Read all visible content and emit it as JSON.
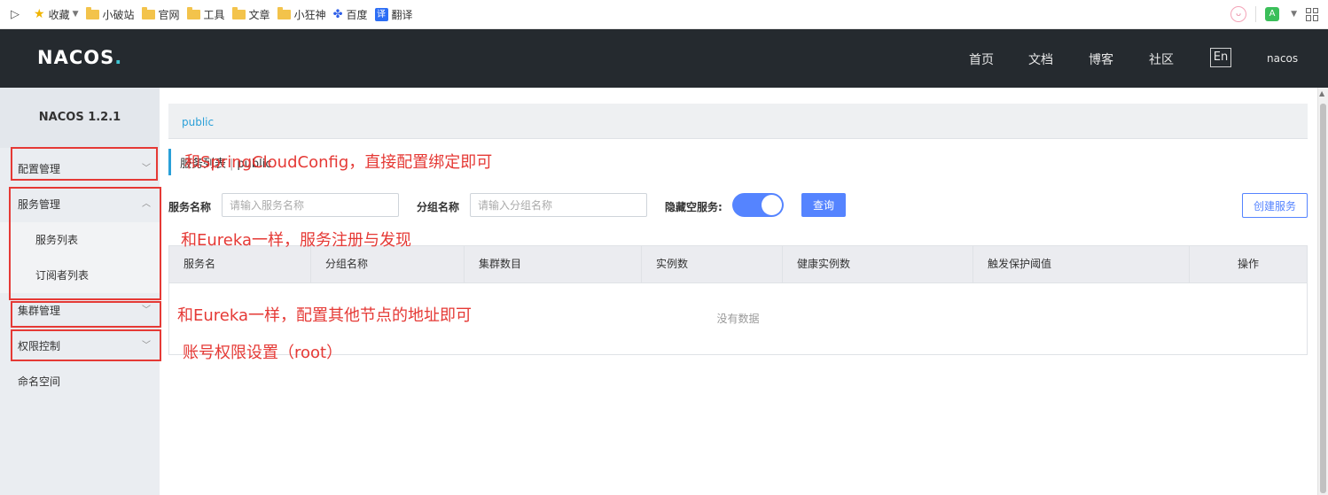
{
  "browser": {
    "bookmarks": [
      {
        "label": "收藏",
        "icon": "star-icon"
      },
      {
        "label": "小破站",
        "icon": "folder-icon"
      },
      {
        "label": "官网",
        "icon": "folder-icon"
      },
      {
        "label": "工具",
        "icon": "folder-icon"
      },
      {
        "label": "文章",
        "icon": "folder-icon"
      },
      {
        "label": "小狂神",
        "icon": "folder-icon"
      },
      {
        "label": "百度",
        "icon": "baidu-paw-icon"
      },
      {
        "label": "翻译",
        "icon": "translate-icon"
      }
    ],
    "translate_glyph": "译",
    "right_icons": [
      "cat-icon",
      "extension-icon",
      "apps-grid-icon"
    ]
  },
  "header": {
    "logo": "NACOS",
    "logo_dot": ".",
    "nav": [
      "首页",
      "文档",
      "博客",
      "社区"
    ],
    "lang": "En",
    "user": "nacos"
  },
  "sidebar": {
    "title": "NACOS 1.2.1",
    "items": [
      {
        "label": "配置管理",
        "chevron": "down"
      },
      {
        "label": "服务管理",
        "chevron": "up"
      },
      {
        "label": "服务列表"
      },
      {
        "label": "订阅者列表"
      },
      {
        "label": "集群管理",
        "chevron": "down"
      },
      {
        "label": "权限控制",
        "chevron": "down"
      },
      {
        "label": "命名空间"
      }
    ]
  },
  "main": {
    "namespace": "public",
    "title": "服务列表",
    "title_divider": "|",
    "title_namespace": "public",
    "filters": {
      "service_name_label": "服务名称",
      "service_name_placeholder": "请输入服务名称",
      "group_name_label": "分组名称",
      "group_name_placeholder": "请输入分组名称",
      "hide_empty_label": "隐藏空服务:",
      "hide_empty_on": true,
      "query_button": "查询",
      "create_button": "创建服务"
    },
    "table": {
      "columns": [
        "服务名",
        "分组名称",
        "集群数目",
        "实例数",
        "健康实例数",
        "触发保护阈值",
        "操作"
      ],
      "rows": [],
      "empty_text": "没有数据"
    }
  },
  "annotations": {
    "accent_color": "#e53935",
    "notes": [
      "和SpringCloudConfig，直接配置绑定即可",
      "和Eureka一样，服务注册与发现",
      "和Eureka一样，配置其他节点的地址即可",
      "账号权限设置（root）"
    ]
  },
  "colors": {
    "header_bg": "#252a2f",
    "sidebar_bg": "#eaedf1",
    "primary": "#5584ff",
    "link": "#2aa0d8"
  }
}
